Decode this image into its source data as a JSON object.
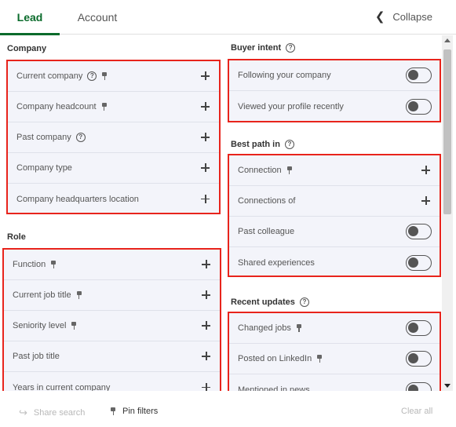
{
  "tabs": {
    "lead": "Lead",
    "account": "Account",
    "collapse": "Collapse"
  },
  "sections": {
    "company": {
      "title": "Company",
      "items": [
        {
          "label": "Current company",
          "help": true,
          "pin": true,
          "control": "plus"
        },
        {
          "label": "Company headcount",
          "help": false,
          "pin": true,
          "control": "plus"
        },
        {
          "label": "Past company",
          "help": true,
          "pin": false,
          "control": "plus"
        },
        {
          "label": "Company type",
          "help": false,
          "pin": false,
          "control": "plus"
        },
        {
          "label": "Company headquarters location",
          "help": false,
          "pin": false,
          "control": "plus"
        }
      ]
    },
    "role": {
      "title": "Role",
      "items": [
        {
          "label": "Function",
          "help": false,
          "pin": true,
          "control": "plus"
        },
        {
          "label": "Current job title",
          "help": false,
          "pin": true,
          "control": "plus"
        },
        {
          "label": "Seniority level",
          "help": false,
          "pin": true,
          "control": "plus"
        },
        {
          "label": "Past job title",
          "help": false,
          "pin": false,
          "control": "plus"
        },
        {
          "label": "Years in current company",
          "help": false,
          "pin": false,
          "control": "plus"
        }
      ]
    },
    "buyer_intent": {
      "title": "Buyer intent",
      "items": [
        {
          "label": "Following your company",
          "help": false,
          "pin": false,
          "control": "toggle"
        },
        {
          "label": "Viewed your profile recently",
          "help": false,
          "pin": false,
          "control": "toggle"
        }
      ]
    },
    "best_path": {
      "title": "Best path in",
      "items": [
        {
          "label": "Connection",
          "help": false,
          "pin": true,
          "control": "plus"
        },
        {
          "label": "Connections of",
          "help": false,
          "pin": false,
          "control": "plus"
        },
        {
          "label": "Past colleague",
          "help": false,
          "pin": false,
          "control": "toggle"
        },
        {
          "label": "Shared experiences",
          "help": false,
          "pin": false,
          "control": "toggle"
        }
      ]
    },
    "recent_updates": {
      "title": "Recent updates",
      "items": [
        {
          "label": "Changed jobs",
          "help": false,
          "pin": true,
          "control": "toggle"
        },
        {
          "label": "Posted on LinkedIn",
          "help": false,
          "pin": true,
          "control": "toggle"
        },
        {
          "label": "Mentioned in news",
          "help": false,
          "pin": false,
          "control": "toggle"
        }
      ]
    }
  },
  "footer": {
    "share_search": "Share search",
    "pin_filters": "Pin filters",
    "clear_all": "Clear all"
  },
  "colors": {
    "accent": "#0a6b2b",
    "highlight_border": "#e8241c",
    "panel_bg": "#f3f4fa"
  }
}
